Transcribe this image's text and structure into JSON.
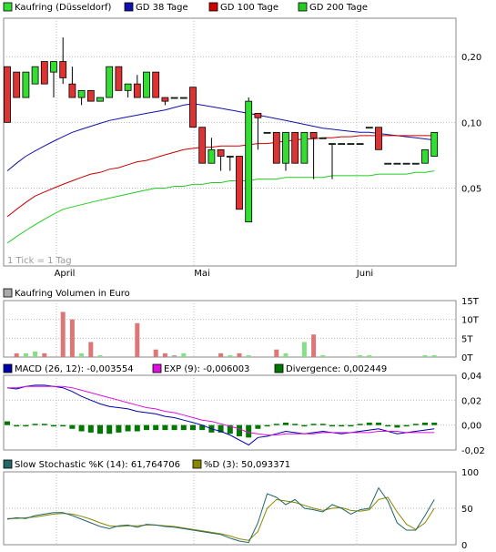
{
  "colors": {
    "price_up": "#33dd33",
    "price_down": "#dd3333",
    "gd38": "#1010aa",
    "gd100": "#cc0000",
    "gd200": "#22cc22",
    "macd": "#0000aa",
    "exp": "#dd11dd",
    "divergence": "#007700",
    "slow_k": "#226666",
    "slow_d": "#888800",
    "grid": "#bbbbbb",
    "volume_gray": "#aaaaaa"
  },
  "main": {
    "legend": [
      {
        "label": "Kaufring (Düsseldorf)",
        "color": "#33dd33"
      },
      {
        "label": "GD 38 Tage",
        "color": "#1010aa"
      },
      {
        "label": "GD 100 Tage",
        "color": "#cc0000"
      },
      {
        "label": "GD 200 Tage",
        "color": "#22cc22"
      }
    ],
    "note": "1 Tick = 1 Tag"
  },
  "volume": {
    "legend_label": "Kaufring Volumen in Euro"
  },
  "macd": {
    "legend": [
      {
        "label": "MACD (26, 12): -0,003554",
        "color": "#0000aa"
      },
      {
        "label": "EXP (9): -0,006003",
        "color": "#dd11dd"
      },
      {
        "label": "Divergence: 0,002449",
        "color": "#007700"
      }
    ]
  },
  "stoch": {
    "legend": [
      {
        "label": "Slow Stochastic %K (14): 61,764706",
        "color": "#226666"
      },
      {
        "label": "%D (3): 50,093371",
        "color": "#888800"
      }
    ]
  },
  "chart_data": [
    {
      "type": "candlestick",
      "title": "Kaufring (Düsseldorf)",
      "x_ticks": [
        "April",
        "Mai",
        "Juni"
      ],
      "y_ticks": [
        "0,20",
        "0,10",
        "0,05"
      ],
      "series": [
        {
          "name": "Kaufring (Düsseldorf)",
          "candles": [
            [
              0.18,
              0.18,
              0.1,
              0.1
            ],
            [
              0.17,
              0.17,
              0.13,
              0.13
            ],
            [
              0.13,
              0.17,
              0.13,
              0.17
            ],
            [
              0.15,
              0.18,
              0.15,
              0.18
            ],
            [
              0.19,
              0.19,
              0.15,
              0.15
            ],
            [
              0.17,
              0.19,
              0.13,
              0.19
            ],
            [
              0.19,
              0.245,
              0.15,
              0.16
            ],
            [
              0.15,
              0.18,
              0.13,
              0.13
            ],
            [
              0.13,
              0.14,
              0.12,
              0.14
            ],
            [
              0.14,
              0.14,
              0.125,
              0.125
            ],
            [
              0.125,
              0.13,
              0.125,
              0.13
            ],
            [
              0.13,
              0.18,
              0.13,
              0.18
            ],
            [
              0.18,
              0.18,
              0.14,
              0.14
            ],
            [
              0.14,
              0.15,
              0.13,
              0.15
            ],
            [
              0.15,
              0.165,
              0.13,
              0.13
            ],
            [
              0.13,
              0.17,
              0.13,
              0.17
            ],
            [
              0.17,
              0.17,
              0.13,
              0.13
            ],
            [
              0.13,
              0.13,
              0.12,
              0.125
            ],
            [
              0.13,
              0.13,
              0.13,
              0.13
            ],
            [
              0.13,
              0.13,
              0.13,
              0.13
            ],
            [
              0.145,
              0.145,
              0.095,
              0.095
            ],
            [
              0.095,
              0.095,
              0.065,
              0.065
            ],
            [
              0.065,
              0.085,
              0.065,
              0.075
            ],
            [
              0.075,
              0.075,
              0.06,
              0.07
            ],
            [
              0.07,
              0.07,
              0.06,
              0.07
            ],
            [
              0.07,
              0.07,
              0.04,
              0.04
            ],
            [
              0.035,
              0.13,
              0.035,
              0.125
            ],
            [
              0.11,
              0.11,
              0.075,
              0.105
            ],
            [
              0.09,
              0.09,
              0.09,
              0.09
            ],
            [
              0.09,
              0.09,
              0.065,
              0.065
            ],
            [
              0.065,
              0.09,
              0.06,
              0.09
            ],
            [
              0.09,
              0.09,
              0.065,
              0.065
            ],
            [
              0.065,
              0.09,
              0.065,
              0.09
            ],
            [
              0.09,
              0.09,
              0.055,
              0.085
            ],
            [
              0.085,
              0.085,
              0.085,
              0.085
            ],
            [
              0.08,
              0.08,
              0.055,
              0.08
            ],
            [
              0.08,
              0.08,
              0.08,
              0.08
            ],
            [
              0.08,
              0.08,
              0.08,
              0.08
            ],
            [
              0.08,
              0.08,
              0.08,
              0.08
            ],
            [
              0.095,
              0.095,
              0.095,
              0.095
            ],
            [
              0.095,
              0.095,
              0.075,
              0.075
            ],
            [
              0.065,
              0.065,
              0.065,
              0.065
            ],
            [
              0.065,
              0.065,
              0.065,
              0.065
            ],
            [
              0.065,
              0.065,
              0.065,
              0.065
            ],
            [
              0.065,
              0.065,
              0.065,
              0.065
            ],
            [
              0.065,
              0.075,
              0.065,
              0.075
            ],
            [
              0.07,
              0.09,
              0.07,
              0.09
            ]
          ]
        },
        {
          "name": "GD 38 Tage",
          "values": [
            0.06,
            0.065,
            0.07,
            0.074,
            0.078,
            0.082,
            0.086,
            0.09,
            0.093,
            0.096,
            0.099,
            0.102,
            0.104,
            0.106,
            0.108,
            0.11,
            0.112,
            0.114,
            0.117,
            0.12,
            0.122,
            0.12,
            0.118,
            0.116,
            0.114,
            0.112,
            0.11,
            0.108,
            0.106,
            0.104,
            0.102,
            0.1,
            0.098,
            0.096,
            0.094,
            0.093,
            0.092,
            0.091,
            0.09,
            0.09,
            0.089,
            0.088,
            0.087,
            0.086,
            0.085,
            0.084,
            0.083
          ]
        },
        {
          "name": "GD 100 Tage",
          "values": [
            0.037,
            0.04,
            0.043,
            0.046,
            0.048,
            0.05,
            0.052,
            0.054,
            0.056,
            0.058,
            0.059,
            0.061,
            0.062,
            0.064,
            0.066,
            0.067,
            0.069,
            0.071,
            0.073,
            0.075,
            0.076,
            0.077,
            0.077,
            0.078,
            0.078,
            0.078,
            0.079,
            0.08,
            0.08,
            0.081,
            0.082,
            0.083,
            0.084,
            0.084,
            0.085,
            0.085,
            0.086,
            0.086,
            0.087,
            0.087,
            0.087,
            0.087,
            0.087,
            0.087,
            0.087,
            0.087,
            0.087
          ]
        },
        {
          "name": "GD 200 Tage",
          "values": [
            0.028,
            0.03,
            0.032,
            0.034,
            0.036,
            0.038,
            0.04,
            0.041,
            0.042,
            0.043,
            0.044,
            0.045,
            0.046,
            0.047,
            0.048,
            0.049,
            0.05,
            0.05,
            0.051,
            0.051,
            0.052,
            0.052,
            0.053,
            0.053,
            0.054,
            0.054,
            0.054,
            0.055,
            0.055,
            0.055,
            0.056,
            0.056,
            0.056,
            0.056,
            0.056,
            0.057,
            0.057,
            0.057,
            0.057,
            0.057,
            0.058,
            0.058,
            0.058,
            0.058,
            0.059,
            0.059,
            0.06
          ]
        }
      ]
    },
    {
      "type": "bar",
      "title": "Kaufring Volumen in Euro",
      "y_ticks": [
        "15T",
        "10T",
        "5T",
        "0T"
      ],
      "ylim": [
        0,
        15
      ],
      "series": [
        {
          "name": "Kaufring Volumen in Euro",
          "values": [
            0,
            1,
            1,
            1.5,
            1,
            0,
            12,
            10,
            1,
            4,
            0.5,
            0,
            0,
            0,
            9,
            0,
            2,
            1,
            0.5,
            1,
            0,
            0,
            0,
            1,
            0.5,
            1,
            0.5,
            0,
            0,
            2,
            1,
            0,
            4,
            6,
            0.5,
            0,
            0,
            0,
            0.5,
            0.5,
            0,
            0,
            0,
            0,
            0,
            0.5,
            0.5
          ]
        }
      ]
    },
    {
      "type": "line",
      "title": "MACD",
      "y_ticks": [
        "0,04",
        "0,02",
        "0,00",
        "-0,02"
      ],
      "ylim": [
        -0.02,
        0.04
      ],
      "series": [
        {
          "name": "MACD (26, 12)",
          "values": [
            0.03,
            0.029,
            0.031,
            0.032,
            0.032,
            0.031,
            0.03,
            0.027,
            0.023,
            0.02,
            0.017,
            0.015,
            0.014,
            0.013,
            0.011,
            0.01,
            0.009,
            0.007,
            0.006,
            0.004,
            0.002,
            0.0,
            -0.003,
            -0.005,
            -0.008,
            -0.012,
            -0.016,
            -0.01,
            -0.009,
            -0.007,
            -0.005,
            -0.006,
            -0.007,
            -0.006,
            -0.005,
            -0.006,
            -0.007,
            -0.006,
            -0.005,
            -0.004,
            -0.003,
            -0.005,
            -0.007,
            -0.006,
            -0.005,
            -0.004,
            -0.003
          ]
        },
        {
          "name": "EXP (9)",
          "values": [
            0.03,
            0.03,
            0.031,
            0.031,
            0.031,
            0.031,
            0.031,
            0.03,
            0.028,
            0.026,
            0.024,
            0.022,
            0.02,
            0.018,
            0.016,
            0.014,
            0.013,
            0.011,
            0.01,
            0.008,
            0.006,
            0.004,
            0.003,
            0.001,
            -0.001,
            -0.003,
            -0.006,
            -0.007,
            -0.008,
            -0.008,
            -0.007,
            -0.007,
            -0.007,
            -0.007,
            -0.006,
            -0.006,
            -0.006,
            -0.006,
            -0.006,
            -0.006,
            -0.005,
            -0.005,
            -0.005,
            -0.006,
            -0.006,
            -0.006,
            -0.006
          ]
        },
        {
          "name": "Divergence",
          "values": [
            0.003,
            0.0,
            0.0,
            0.001,
            0.001,
            0.0,
            -0.001,
            -0.003,
            -0.005,
            -0.006,
            -0.007,
            -0.007,
            -0.006,
            -0.005,
            -0.005,
            -0.004,
            -0.004,
            -0.004,
            -0.004,
            -0.004,
            -0.004,
            -0.004,
            -0.006,
            -0.006,
            -0.007,
            -0.009,
            -0.01,
            -0.003,
            -0.001,
            0.001,
            0.002,
            0.001,
            0.0,
            0.001,
            0.001,
            0.0,
            -0.001,
            0.0,
            0.001,
            0.002,
            0.002,
            0.0,
            -0.002,
            0.0,
            0.001,
            0.002,
            0.002
          ]
        }
      ]
    },
    {
      "type": "line",
      "title": "Slow Stochastic",
      "y_ticks": [
        "100",
        "50",
        "0"
      ],
      "ylim": [
        0,
        100
      ],
      "series": [
        {
          "name": "Slow Stochastic %K (14)",
          "values": [
            35,
            37,
            36,
            40,
            42,
            44,
            44,
            40,
            35,
            30,
            25,
            22,
            26,
            27,
            24,
            28,
            27,
            25,
            24,
            22,
            20,
            18,
            16,
            14,
            9,
            5,
            3,
            30,
            70,
            65,
            55,
            62,
            50,
            48,
            45,
            55,
            50,
            42,
            48,
            50,
            78,
            60,
            30,
            20,
            20,
            40,
            62
          ]
        },
        {
          "name": "%D (3)",
          "values": [
            36,
            36,
            37,
            38,
            40,
            42,
            43,
            42,
            39,
            35,
            30,
            26,
            25,
            26,
            26,
            27,
            27,
            26,
            25,
            23,
            21,
            19,
            17,
            15,
            12,
            8,
            6,
            18,
            50,
            62,
            60,
            58,
            54,
            50,
            47,
            50,
            51,
            47,
            46,
            48,
            62,
            65,
            45,
            28,
            21,
            30,
            50
          ]
        }
      ]
    }
  ]
}
